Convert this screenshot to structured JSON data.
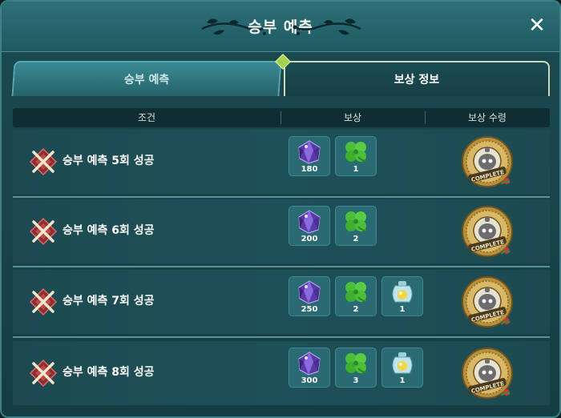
{
  "window": {
    "title": "승부 예측",
    "close_label": "✕"
  },
  "tabs": [
    {
      "label": "승부 예측",
      "active": false
    },
    {
      "label": "보상 정보",
      "active": true
    }
  ],
  "table": {
    "headers": [
      "조건",
      "보상",
      "보상 수령"
    ],
    "rows": [
      {
        "condition": "승부 예측 5회 성공",
        "status": "failed",
        "rewards": [
          {
            "item": "crystal",
            "qty": "180"
          },
          {
            "item": "clover",
            "qty": "1"
          }
        ],
        "claim": "COMPLETE"
      },
      {
        "condition": "승부 예측 6회 성공",
        "status": "failed",
        "rewards": [
          {
            "item": "crystal",
            "qty": "200"
          },
          {
            "item": "clover",
            "qty": "2"
          }
        ],
        "claim": "COMPLETE"
      },
      {
        "condition": "승부 예측 7회 성공",
        "status": "failed",
        "rewards": [
          {
            "item": "crystal",
            "qty": "250"
          },
          {
            "item": "clover",
            "qty": "2"
          },
          {
            "item": "potion",
            "qty": "1"
          }
        ],
        "claim": "COMPLETE"
      },
      {
        "condition": "승부 예측 8회 성공",
        "status": "failed",
        "rewards": [
          {
            "item": "crystal",
            "qty": "300"
          },
          {
            "item": "clover",
            "qty": "3"
          },
          {
            "item": "potion",
            "qty": "1"
          }
        ],
        "claim": "COMPLETE"
      }
    ]
  },
  "icons": {
    "close": "close-icon",
    "condition": "crossed-out-diamond-icon",
    "crystal": "purple-crystal-icon",
    "clover": "four-leaf-clover-icon",
    "potion": "potion-jar-icon",
    "medal": "complete-medal-icon"
  },
  "colors": {
    "panel": "#1b4a51",
    "header": "#0f2d33",
    "slot": "#2a6a72",
    "medal_gold": "#c9a24b",
    "fail_red": "#a13a3a"
  }
}
